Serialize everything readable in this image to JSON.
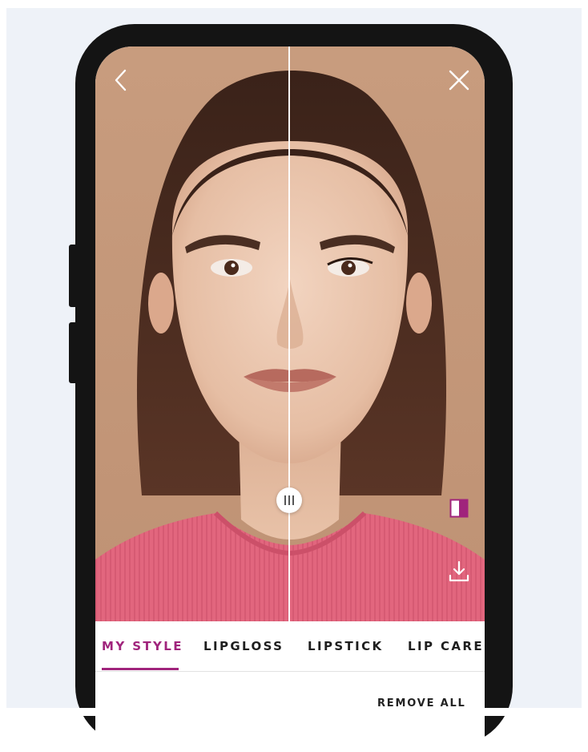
{
  "tabs": [
    {
      "label": "MY STYLE",
      "active": true
    },
    {
      "label": "LIPGLOSS",
      "active": false
    },
    {
      "label": "LIPSTICK",
      "active": false
    },
    {
      "label": "LIP CARE",
      "active": false
    }
  ],
  "actions": {
    "remove_all": "REMOVE ALL"
  },
  "icons": {
    "back": "chevron-left-icon",
    "close": "close-icon",
    "compare": "compare-toggle-icon",
    "download": "download-icon",
    "slider_handle": "drag-handle-icon"
  },
  "colors": {
    "accent": "#a0247c",
    "background": "#eef2f8",
    "photo_backdrop": "#c89c7e",
    "shirt": "#e2667e"
  },
  "compare_slider": {
    "position_fraction": 0.5
  }
}
